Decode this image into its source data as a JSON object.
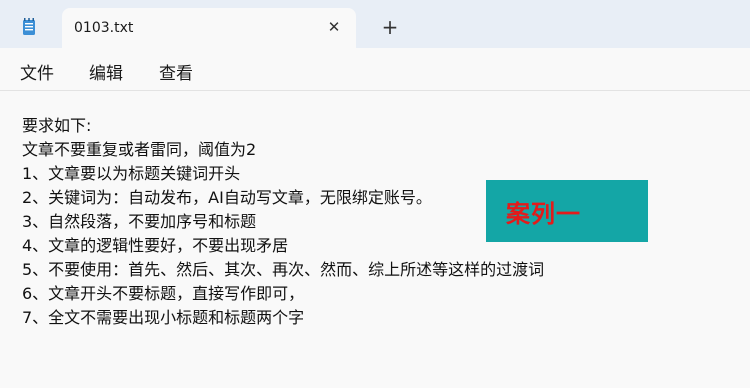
{
  "window": {
    "tab_title": "0103.txt",
    "close_symbol": "✕",
    "new_tab_symbol": "+"
  },
  "menu": {
    "file": "文件",
    "edit": "编辑",
    "view": "查看"
  },
  "editor": {
    "lines": [
      "要求如下:",
      "文章不要重复或者雷同，阈值为2",
      "1、文章要以为标题关键词开头",
      "2、关键词为：自动发布，AI自动写文章，无限绑定账号。",
      "3、自然段落，不要加序号和标题",
      "4、文章的逻辑性要好，不要出现矛居",
      "5、不要使用：首先、然后、其次、再次、然而、综上所述等这样的过渡词",
      "6、文章开头不要标题，直接写作即可，",
      "7、全文不需要出现小标题和标题两个字"
    ]
  },
  "overlay": {
    "label": "案列一",
    "background_color": "#14a6a6",
    "text_color": "#e31b1b"
  },
  "icons": {
    "app": "notepad-icon",
    "close": "close-icon",
    "new_tab": "plus-icon"
  }
}
